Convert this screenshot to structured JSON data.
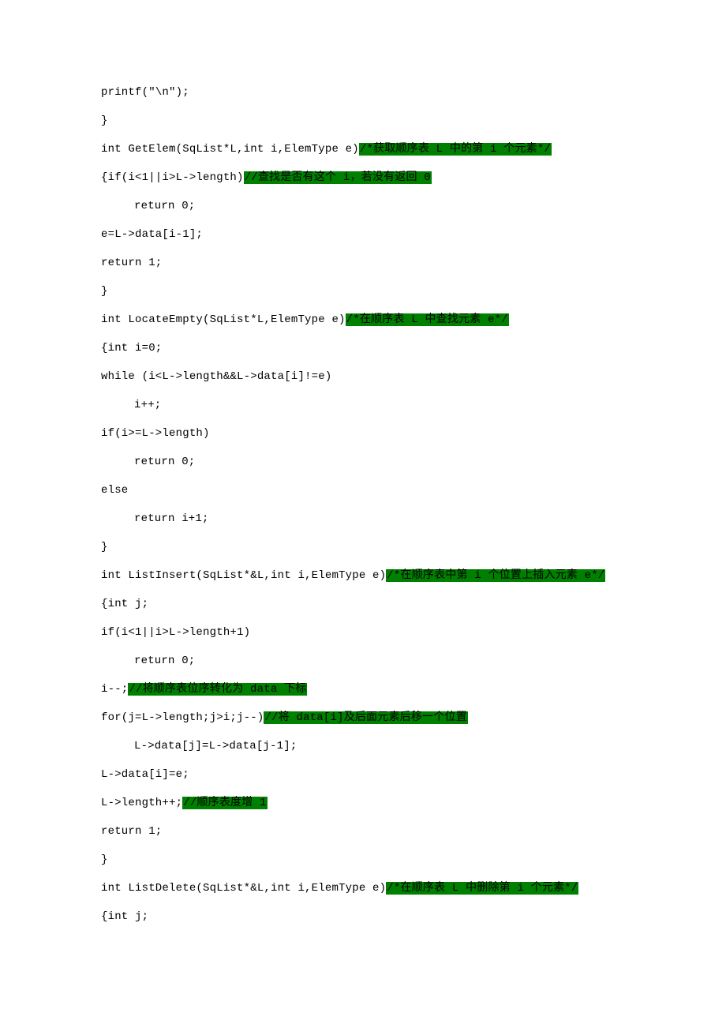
{
  "lines": [
    {
      "pre": "printf(\"\\n\");",
      "hl": "",
      "post": "",
      "indent": false
    },
    {
      "pre": "}",
      "hl": "",
      "post": "",
      "indent": false
    },
    {
      "pre": "int GetElem(SqList*L,int i,ElemType e)",
      "hl": "/*获取顺序表 L 中的第 i 个元素*/",
      "post": "",
      "indent": false
    },
    {
      "pre": "{if(i<1||i>L->length)",
      "hl": "//查找是否有这个 i，若没有返回 0",
      "post": "",
      "indent": false
    },
    {
      "pre": "return 0;",
      "hl": "",
      "post": "",
      "indent": true
    },
    {
      "pre": "e=L->data[i-1];",
      "hl": "",
      "post": "",
      "indent": false
    },
    {
      "pre": "return 1;",
      "hl": "",
      "post": "",
      "indent": false
    },
    {
      "pre": "}",
      "hl": "",
      "post": "",
      "indent": false
    },
    {
      "pre": "int LocateEmpty(SqList*L,ElemType e)",
      "hl": "/*在顺序表 L 中查找元素 e*/",
      "post": "",
      "indent": false
    },
    {
      "pre": "{int i=0;",
      "hl": "",
      "post": "",
      "indent": false
    },
    {
      "pre": "while (i<L->length&&L->data[i]!=e)",
      "hl": "",
      "post": "",
      "indent": false
    },
    {
      "pre": "i++;",
      "hl": "",
      "post": "",
      "indent": true
    },
    {
      "pre": "if(i>=L->length)",
      "hl": "",
      "post": "",
      "indent": false
    },
    {
      "pre": "return 0;",
      "hl": "",
      "post": "",
      "indent": true
    },
    {
      "pre": "else",
      "hl": "",
      "post": "",
      "indent": false
    },
    {
      "pre": "return i+1;",
      "hl": "",
      "post": "",
      "indent": true
    },
    {
      "pre": "}",
      "hl": "",
      "post": "",
      "indent": false
    },
    {
      "pre": "int ListInsert(SqList*&L,int i,ElemType e)",
      "hl": "/*在顺序表中第 i 个位置上插入元素 e*/",
      "post": "",
      "indent": false
    },
    {
      "pre": "{int j;",
      "hl": "",
      "post": "",
      "indent": false
    },
    {
      "pre": "if(i<1||i>L->length+1)",
      "hl": "",
      "post": "",
      "indent": false
    },
    {
      "pre": "return 0;",
      "hl": "",
      "post": "",
      "indent": true
    },
    {
      "pre": "i--;",
      "hl": "//将顺序表位序转化为 data 下标",
      "post": "",
      "indent": false
    },
    {
      "pre": "for(j=L->length;j>i;j--)",
      "hl": "//将 data[i]及后面元素后移一个位置",
      "post": "",
      "indent": false
    },
    {
      "pre": "L->data[j]=L->data[j-1];",
      "hl": "",
      "post": "",
      "indent": true
    },
    {
      "pre": "L->data[i]=e;",
      "hl": "",
      "post": "",
      "indent": false
    },
    {
      "pre": "L->length++;",
      "hl": "//顺序表度增 1",
      "post": "",
      "indent": false
    },
    {
      "pre": "return 1;",
      "hl": "",
      "post": "",
      "indent": false
    },
    {
      "pre": "}",
      "hl": "",
      "post": "",
      "indent": false
    },
    {
      "pre": "int ListDelete(SqList*&L,int i,ElemType e)",
      "hl": "/*在顺序表 L 中删除第 i 个元素*/",
      "post": "",
      "indent": false
    },
    {
      "pre": "{int j;",
      "hl": "",
      "post": "",
      "indent": false
    }
  ]
}
